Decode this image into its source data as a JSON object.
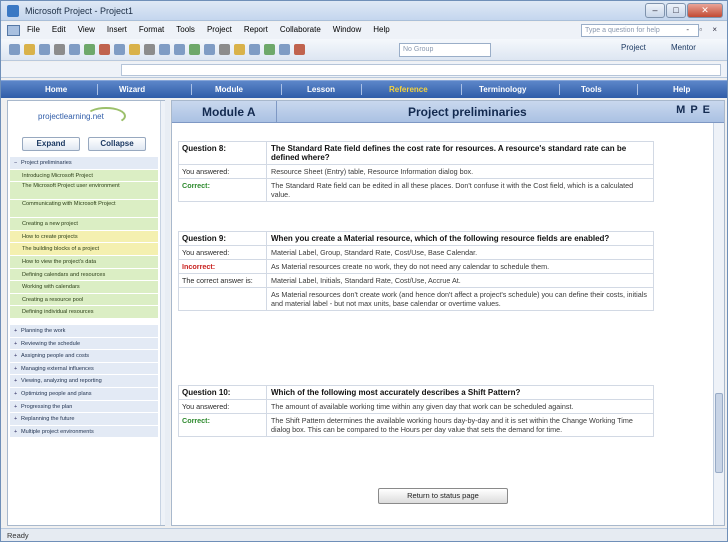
{
  "window": {
    "title": "Microsoft Project - Project1",
    "controls": [
      "–",
      "□",
      "✕"
    ]
  },
  "menu": {
    "items": [
      "File",
      "Edit",
      "View",
      "Insert",
      "Format",
      "Tools",
      "Project",
      "Report",
      "Collaborate",
      "Window",
      "Help"
    ],
    "help_placeholder": "Type a question for help",
    "doc_controls": "- ▫ ×"
  },
  "toolbar": {
    "group_value": "No Group",
    "project_label": "Project",
    "mentor_label": "Mentor"
  },
  "nav": {
    "items": [
      "Home",
      "Wizard",
      "Module",
      "Lesson",
      "Reference",
      "Terminology",
      "Tools",
      "Help"
    ],
    "active": "Reference"
  },
  "left_panel": {
    "logo": "projectlearning.net",
    "expand_label": "Expand",
    "collapse_label": "Collapse",
    "tree": [
      {
        "label": "Project preliminaries",
        "level": 1,
        "toggle": "−"
      },
      {
        "label": "Introducing Microsoft Project",
        "level": 2
      },
      {
        "label": "The Microsoft Project user environment",
        "level": 2
      },
      {
        "label": "Communicating with Microsoft Project",
        "level": 2
      },
      {
        "label": "Creating a new project",
        "level": 2
      },
      {
        "label": "How to create projects",
        "level": 2,
        "highlight": true
      },
      {
        "label": "The building blocks of a project",
        "level": 2,
        "highlight": true
      },
      {
        "label": "How to view the project's data",
        "level": 2
      },
      {
        "label": "Defining calendars and resources",
        "level": 2
      },
      {
        "label": "Working with calendars",
        "level": 2
      },
      {
        "label": "Creating a resource pool",
        "level": 2
      },
      {
        "label": "Defining individual resources",
        "level": 2
      },
      {
        "label": "Planning the work",
        "level": 1,
        "toggle": "+"
      },
      {
        "label": "Reviewing the schedule",
        "level": 1,
        "toggle": "+"
      },
      {
        "label": "Assigning people and costs",
        "level": 1,
        "toggle": "+"
      },
      {
        "label": "Managing external influences",
        "level": 1,
        "toggle": "+"
      },
      {
        "label": "Viewing, analyzing and reporting",
        "level": 1,
        "toggle": "+"
      },
      {
        "label": "Optimizing people and plans",
        "level": 1,
        "toggle": "+"
      },
      {
        "label": "Progressing the plan",
        "level": 1,
        "toggle": "+"
      },
      {
        "label": "Replanning the future",
        "level": 1,
        "toggle": "+"
      },
      {
        "label": "Multiple project environments",
        "level": 1,
        "toggle": "+"
      }
    ]
  },
  "content": {
    "module": "Module A",
    "page_title": "Project preliminaries",
    "mpe": [
      "M",
      "P",
      "E"
    ],
    "q8": {
      "label": "Question 8:",
      "question": "The Standard Rate field defines the cost rate for resources. A resource's standard rate can be defined where?",
      "answered_label": "You answered:",
      "answered": "Resource Sheet (Entry) table, Resource Information dialog box.",
      "result_label": "Correct:",
      "result_text": "The Standard Rate field can be edited in all these places. Don't confuse it with the Cost field, which is a calculated value."
    },
    "q9": {
      "label": "Question 9:",
      "question": "When you create a Material resource, which of the following resource fields are enabled?",
      "answered_label": "You answered:",
      "answered": "Material Label, Group, Standard Rate, Cost/Use, Base Calendar.",
      "result_label": "Incorrect:",
      "result_text": "As Material resources create no work, they do not need any calendar to schedule them.",
      "correct_label": "The correct answer is:",
      "correct_answer": "Material Label, Initials, Standard Rate, Cost/Use, Accrue At.",
      "explanation": "As Material resources don't create work (and hence don't affect a project's schedule) you can define their costs, initials and material label - but not max units, base calendar or overtime values."
    },
    "q10": {
      "label": "Question 10:",
      "question": "Which of the following most accurately describes a Shift Pattern?",
      "answered_label": "You answered:",
      "answered": "The amount of available working time within any given day that work can be scheduled against.",
      "result_label": "Correct:",
      "result_text": "The Shift Pattern determines the available working hours day-by-day and it is set within the Change Working Time dialog box. This can be compared to the Hours per day value that sets the demand for time."
    },
    "return_button": "Return to status page"
  },
  "status": {
    "text": "Ready"
  }
}
